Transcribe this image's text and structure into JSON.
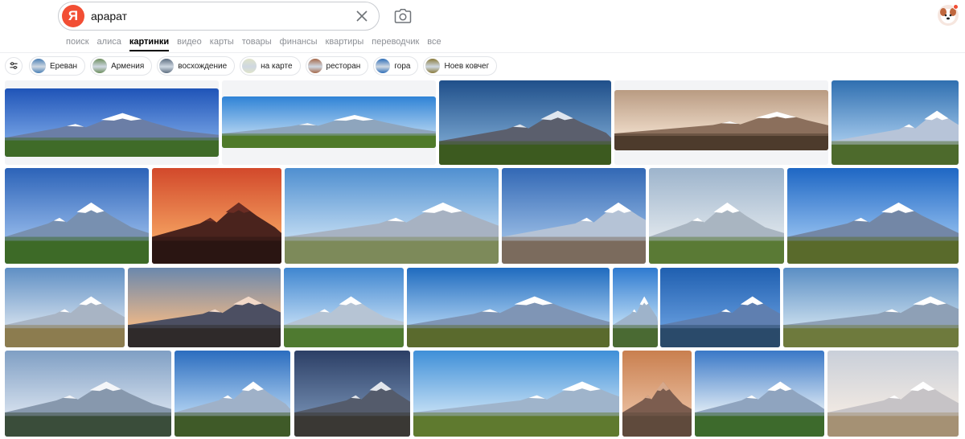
{
  "header": {
    "logo_letter": "Я",
    "query": "арарат"
  },
  "tabs": [
    {
      "label": "поиск",
      "active": false
    },
    {
      "label": "алиса",
      "active": false
    },
    {
      "label": "картинки",
      "active": true
    },
    {
      "label": "видео",
      "active": false
    },
    {
      "label": "карты",
      "active": false
    },
    {
      "label": "товары",
      "active": false
    },
    {
      "label": "финансы",
      "active": false
    },
    {
      "label": "квартиры",
      "active": false
    },
    {
      "label": "переводчик",
      "active": false
    },
    {
      "label": "все",
      "active": false
    }
  ],
  "chips": [
    {
      "label": "Ереван",
      "color": "#4a7fb5"
    },
    {
      "label": "Армения",
      "color": "#6d8f5e"
    },
    {
      "label": "восхождение",
      "color": "#5c6d80"
    },
    {
      "label": "на карте",
      "color": "#dfe3c9"
    },
    {
      "label": "ресторан",
      "color": "#a66a4c"
    },
    {
      "label": "гора",
      "color": "#2f6fb8"
    },
    {
      "label": "Ноев ковчег",
      "color": "#8a7b3c"
    }
  ],
  "images": [
    {
      "sky": "#1f54b8",
      "sky2": "#6d9be0",
      "ground": "#3f6b28",
      "snow": "#ffffff",
      "mtn": "#6b7ea6"
    },
    {
      "sky": "#2f83d6",
      "sky2": "#a8cdef",
      "ground": "#4f7a2a",
      "snow": "#ffffff",
      "mtn": "#8ea5bd"
    },
    {
      "sky": "#1f4f8a",
      "sky2": "#6f9cc8",
      "ground": "#3c5a1f",
      "snow": "#dfe6ef",
      "mtn": "#5b5f6d"
    },
    {
      "sky": "#b99b82",
      "sky2": "#ead6c3",
      "ground": "#4d3b2c",
      "snow": "#ffffff",
      "mtn": "#8b6f5c"
    },
    {
      "sky": "#2f6fb0",
      "sky2": "#9cc3e8",
      "ground": "#4d6a2c",
      "snow": "#ffffff",
      "mtn": "#b7c4d8"
    },
    {
      "sky": "#2c63b8",
      "sky2": "#8cb2e6",
      "ground": "#3d6a27",
      "snow": "#ffffff",
      "mtn": "#7890b0"
    },
    {
      "sky": "#d2492b",
      "sky2": "#f29a5c",
      "ground": "#2a1512",
      "snow": "#6a2c23",
      "mtn": "#4a231d"
    },
    {
      "sky": "#4f8fd0",
      "sky2": "#b9d6f0",
      "ground": "#7d8a5a",
      "snow": "#ffffff",
      "mtn": "#a7b2c2"
    },
    {
      "sky": "#3268b5",
      "sky2": "#8fb4e0",
      "ground": "#7b6b5d",
      "snow": "#ffffff",
      "mtn": "#b5c3d6"
    },
    {
      "sky": "#9db4cc",
      "sky2": "#dbe3ea",
      "ground": "#5a7a35",
      "snow": "#ffffff",
      "mtn": "#a9b5c1"
    },
    {
      "sky": "#1e67c4",
      "sky2": "#8ab8ec",
      "ground": "#596a2b",
      "snow": "#ffffff",
      "mtn": "#7387a6"
    },
    {
      "sky": "#5f8fc4",
      "sky2": "#c9d9ea",
      "ground": "#8c7c4f",
      "snow": "#ffffff",
      "mtn": "#a8b4c4"
    },
    {
      "sky": "#6b88ad",
      "sky2": "#e6b58a",
      "ground": "#2f2a2a",
      "snow": "#f2d9c8",
      "mtn": "#4c4f62"
    },
    {
      "sky": "#3f86d0",
      "sky2": "#b8d6f2",
      "ground": "#4f7a30",
      "snow": "#ffffff",
      "mtn": "#b6c4d4"
    },
    {
      "sky": "#1f6bbf",
      "sky2": "#a2c9ee",
      "ground": "#5a6a2d",
      "snow": "#ffffff",
      "mtn": "#7f95b5"
    },
    {
      "sky": "#2e7ad0",
      "sky2": "#b6d8f4",
      "ground": "#4a6a33",
      "snow": "#ffffff",
      "mtn": "#9eb3ca"
    },
    {
      "sky": "#1f5fb0",
      "sky2": "#5d95d8",
      "ground": "#2a4a6a",
      "snow": "#ffffff",
      "mtn": "#5f7fb0"
    },
    {
      "sky": "#5a8ec4",
      "sky2": "#c0d7ea",
      "ground": "#6e7a3d",
      "snow": "#ffffff",
      "mtn": "#8ea0b6"
    },
    {
      "sky": "#7f9fc4",
      "sky2": "#d0dceb",
      "ground": "#3a4d3a",
      "snow": "#f4f6f9",
      "mtn": "#8798ad"
    },
    {
      "sky": "#2b6dbf",
      "sky2": "#a8cbee",
      "ground": "#3f5a28",
      "snow": "#ffffff",
      "mtn": "#9fb1c8"
    },
    {
      "sky": "#2c3f66",
      "sky2": "#6b84a8",
      "ground": "#3a3834",
      "snow": "#e2e6ec",
      "mtn": "#545b6b"
    },
    {
      "sky": "#3f8fd8",
      "sky2": "#bcdaf3",
      "ground": "#5f7a2f",
      "snow": "#ffffff",
      "mtn": "#9fb4cb"
    },
    {
      "sky": "#c97f4f",
      "sky2": "#e7b897",
      "ground": "#5f4a3c",
      "snow": "#d7a98c",
      "mtn": "#7c5d4f"
    },
    {
      "sky": "#3a78c7",
      "sky2": "#d8e6f3",
      "ground": "#3d6a2c",
      "snow": "#ffffff",
      "mtn": "#8fa4bf"
    },
    {
      "sky": "#c9cfd9",
      "sky2": "#efe8e2",
      "ground": "#a59174",
      "snow": "#ffffff",
      "mtn": "#c6c3c6"
    }
  ]
}
